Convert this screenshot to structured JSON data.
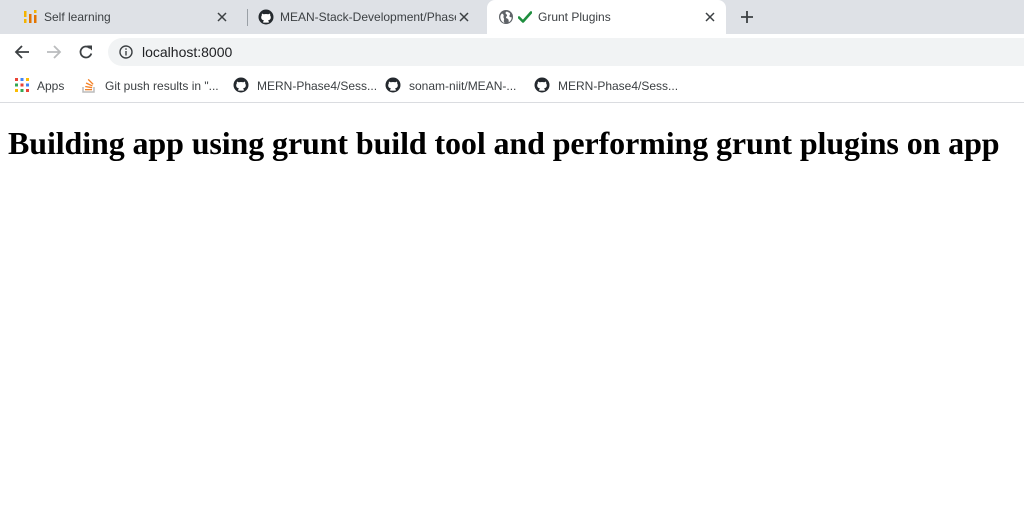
{
  "tabs": [
    {
      "title": "Self learning",
      "icon": "bar-chart-icon"
    },
    {
      "title": "MEAN-Stack-Development/Phase",
      "icon": "github-icon"
    },
    {
      "title": "Grunt Plugins",
      "icon": "globe-icon",
      "badge_icon": "checkmark-icon",
      "active": true
    }
  ],
  "toolbar": {
    "url": "localhost:8000"
  },
  "bookmarks": [
    {
      "label": "Apps",
      "icon": "apps-grid-icon"
    },
    {
      "label": "Git push results in \"...",
      "icon": "stackoverflow-icon"
    },
    {
      "label": "MERN-Phase4/Sess...",
      "icon": "github-icon"
    },
    {
      "label": "sonam-niit/MEAN-...",
      "icon": "github-icon"
    },
    {
      "label": "MERN-Phase4/Sess...",
      "icon": "github-icon"
    }
  ],
  "page": {
    "heading": "Building app using grunt build tool and performing grunt plugins on app"
  },
  "colors": {
    "tabstrip_bg": "#dee1e6",
    "omnibox_bg": "#f1f3f4",
    "check_green": "#1e8e3e"
  }
}
